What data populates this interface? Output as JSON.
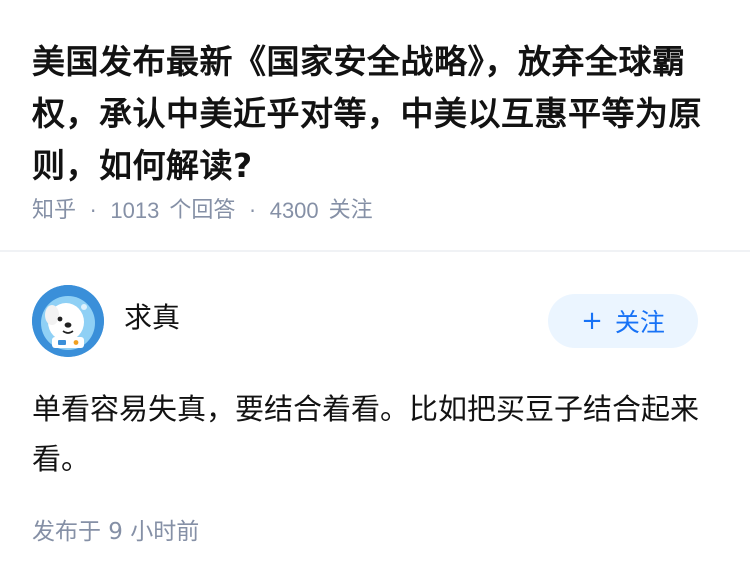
{
  "question": {
    "title": "美国发布最新《国家安全战略》，放弃全球霸权，承认中美近乎对等，中美以互惠平等为原则，如何解读?",
    "source": "知乎",
    "answer_count": "1013",
    "answer_label": "个回答",
    "follower_count": "4300",
    "follower_label": "关注"
  },
  "answer": {
    "author_name": "求真",
    "follow_label": "关注",
    "follow_plus": "+",
    "content": "单看容易失真，要结合着看。比如把买豆子结合起来看。",
    "published": "发布于 9 小时前"
  },
  "icons": {
    "avatar": "cartoon-dog-avatar-icon",
    "follow": "plus-icon"
  },
  "colors": {
    "title": "#121212",
    "meta": "#8590a6",
    "follow_bg": "#ebf5ff",
    "follow_text": "#1772f6",
    "avatar_bg": "#3a8fd9"
  }
}
